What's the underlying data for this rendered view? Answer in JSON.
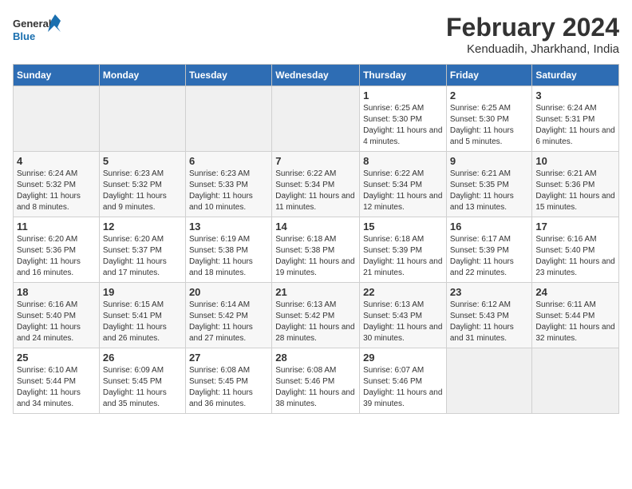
{
  "logo": {
    "line1": "General",
    "line2": "Blue"
  },
  "title": "February 2024",
  "location": "Kenduadih, Jharkhand, India",
  "days_of_week": [
    "Sunday",
    "Monday",
    "Tuesday",
    "Wednesday",
    "Thursday",
    "Friday",
    "Saturday"
  ],
  "weeks": [
    [
      {
        "num": "",
        "info": ""
      },
      {
        "num": "",
        "info": ""
      },
      {
        "num": "",
        "info": ""
      },
      {
        "num": "",
        "info": ""
      },
      {
        "num": "1",
        "info": "Sunrise: 6:25 AM\nSunset: 5:30 PM\nDaylight: 11 hours and 4 minutes."
      },
      {
        "num": "2",
        "info": "Sunrise: 6:25 AM\nSunset: 5:30 PM\nDaylight: 11 hours and 5 minutes."
      },
      {
        "num": "3",
        "info": "Sunrise: 6:24 AM\nSunset: 5:31 PM\nDaylight: 11 hours and 6 minutes."
      }
    ],
    [
      {
        "num": "4",
        "info": "Sunrise: 6:24 AM\nSunset: 5:32 PM\nDaylight: 11 hours and 8 minutes."
      },
      {
        "num": "5",
        "info": "Sunrise: 6:23 AM\nSunset: 5:32 PM\nDaylight: 11 hours and 9 minutes."
      },
      {
        "num": "6",
        "info": "Sunrise: 6:23 AM\nSunset: 5:33 PM\nDaylight: 11 hours and 10 minutes."
      },
      {
        "num": "7",
        "info": "Sunrise: 6:22 AM\nSunset: 5:34 PM\nDaylight: 11 hours and 11 minutes."
      },
      {
        "num": "8",
        "info": "Sunrise: 6:22 AM\nSunset: 5:34 PM\nDaylight: 11 hours and 12 minutes."
      },
      {
        "num": "9",
        "info": "Sunrise: 6:21 AM\nSunset: 5:35 PM\nDaylight: 11 hours and 13 minutes."
      },
      {
        "num": "10",
        "info": "Sunrise: 6:21 AM\nSunset: 5:36 PM\nDaylight: 11 hours and 15 minutes."
      }
    ],
    [
      {
        "num": "11",
        "info": "Sunrise: 6:20 AM\nSunset: 5:36 PM\nDaylight: 11 hours and 16 minutes."
      },
      {
        "num": "12",
        "info": "Sunrise: 6:20 AM\nSunset: 5:37 PM\nDaylight: 11 hours and 17 minutes."
      },
      {
        "num": "13",
        "info": "Sunrise: 6:19 AM\nSunset: 5:38 PM\nDaylight: 11 hours and 18 minutes."
      },
      {
        "num": "14",
        "info": "Sunrise: 6:18 AM\nSunset: 5:38 PM\nDaylight: 11 hours and 19 minutes."
      },
      {
        "num": "15",
        "info": "Sunrise: 6:18 AM\nSunset: 5:39 PM\nDaylight: 11 hours and 21 minutes."
      },
      {
        "num": "16",
        "info": "Sunrise: 6:17 AM\nSunset: 5:39 PM\nDaylight: 11 hours and 22 minutes."
      },
      {
        "num": "17",
        "info": "Sunrise: 6:16 AM\nSunset: 5:40 PM\nDaylight: 11 hours and 23 minutes."
      }
    ],
    [
      {
        "num": "18",
        "info": "Sunrise: 6:16 AM\nSunset: 5:40 PM\nDaylight: 11 hours and 24 minutes."
      },
      {
        "num": "19",
        "info": "Sunrise: 6:15 AM\nSunset: 5:41 PM\nDaylight: 11 hours and 26 minutes."
      },
      {
        "num": "20",
        "info": "Sunrise: 6:14 AM\nSunset: 5:42 PM\nDaylight: 11 hours and 27 minutes."
      },
      {
        "num": "21",
        "info": "Sunrise: 6:13 AM\nSunset: 5:42 PM\nDaylight: 11 hours and 28 minutes."
      },
      {
        "num": "22",
        "info": "Sunrise: 6:13 AM\nSunset: 5:43 PM\nDaylight: 11 hours and 30 minutes."
      },
      {
        "num": "23",
        "info": "Sunrise: 6:12 AM\nSunset: 5:43 PM\nDaylight: 11 hours and 31 minutes."
      },
      {
        "num": "24",
        "info": "Sunrise: 6:11 AM\nSunset: 5:44 PM\nDaylight: 11 hours and 32 minutes."
      }
    ],
    [
      {
        "num": "25",
        "info": "Sunrise: 6:10 AM\nSunset: 5:44 PM\nDaylight: 11 hours and 34 minutes."
      },
      {
        "num": "26",
        "info": "Sunrise: 6:09 AM\nSunset: 5:45 PM\nDaylight: 11 hours and 35 minutes."
      },
      {
        "num": "27",
        "info": "Sunrise: 6:08 AM\nSunset: 5:45 PM\nDaylight: 11 hours and 36 minutes."
      },
      {
        "num": "28",
        "info": "Sunrise: 6:08 AM\nSunset: 5:46 PM\nDaylight: 11 hours and 38 minutes."
      },
      {
        "num": "29",
        "info": "Sunrise: 6:07 AM\nSunset: 5:46 PM\nDaylight: 11 hours and 39 minutes."
      },
      {
        "num": "",
        "info": ""
      },
      {
        "num": "",
        "info": ""
      }
    ]
  ]
}
